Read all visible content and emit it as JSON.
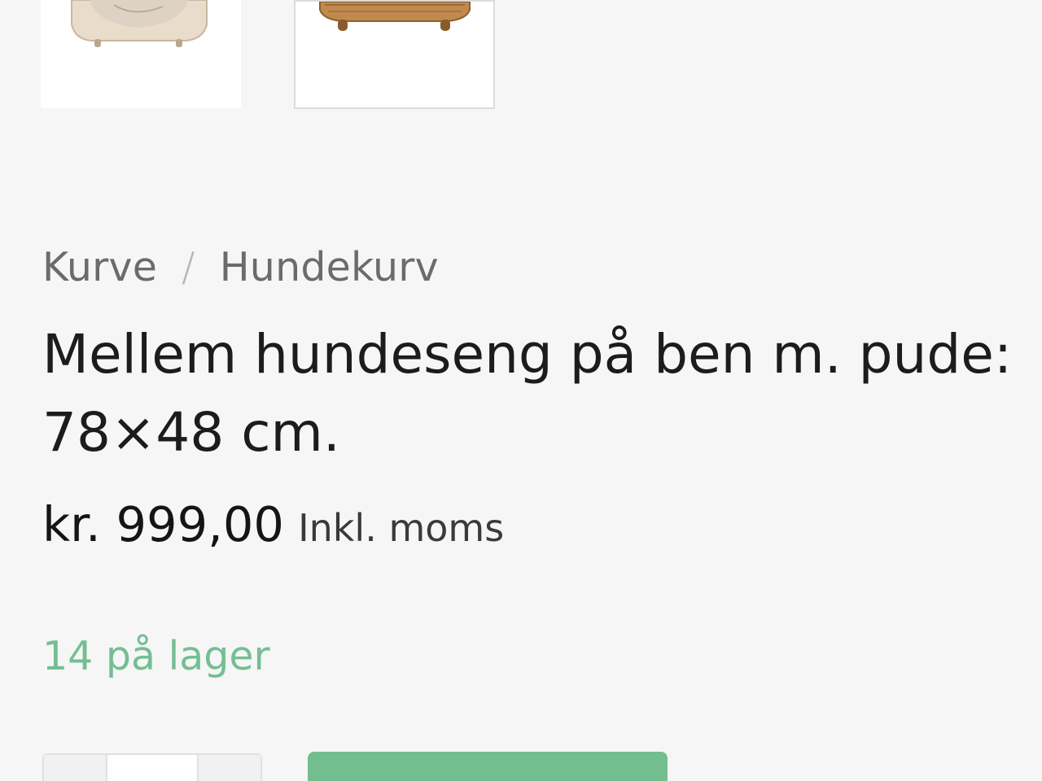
{
  "gallery": {
    "thumbnails": [
      {
        "icon": "cream-wicker-dog-bed-thumbnail",
        "selected": false
      },
      {
        "icon": "natural-wicker-dog-bed-thumbnail",
        "selected": true
      }
    ]
  },
  "breadcrumb": {
    "items": [
      "Kurve",
      "Hundekurv"
    ],
    "separator": "/"
  },
  "product": {
    "title": "Mellem hundeseng på ben m. pude: 78×48 cm.",
    "price": "kr. 999,00",
    "tax_note": "Inkl. moms",
    "stock": "14 på lager"
  },
  "colors": {
    "stock": "#74be93",
    "add_to_cart": "#73be8e",
    "background": "#f6f6f6"
  }
}
